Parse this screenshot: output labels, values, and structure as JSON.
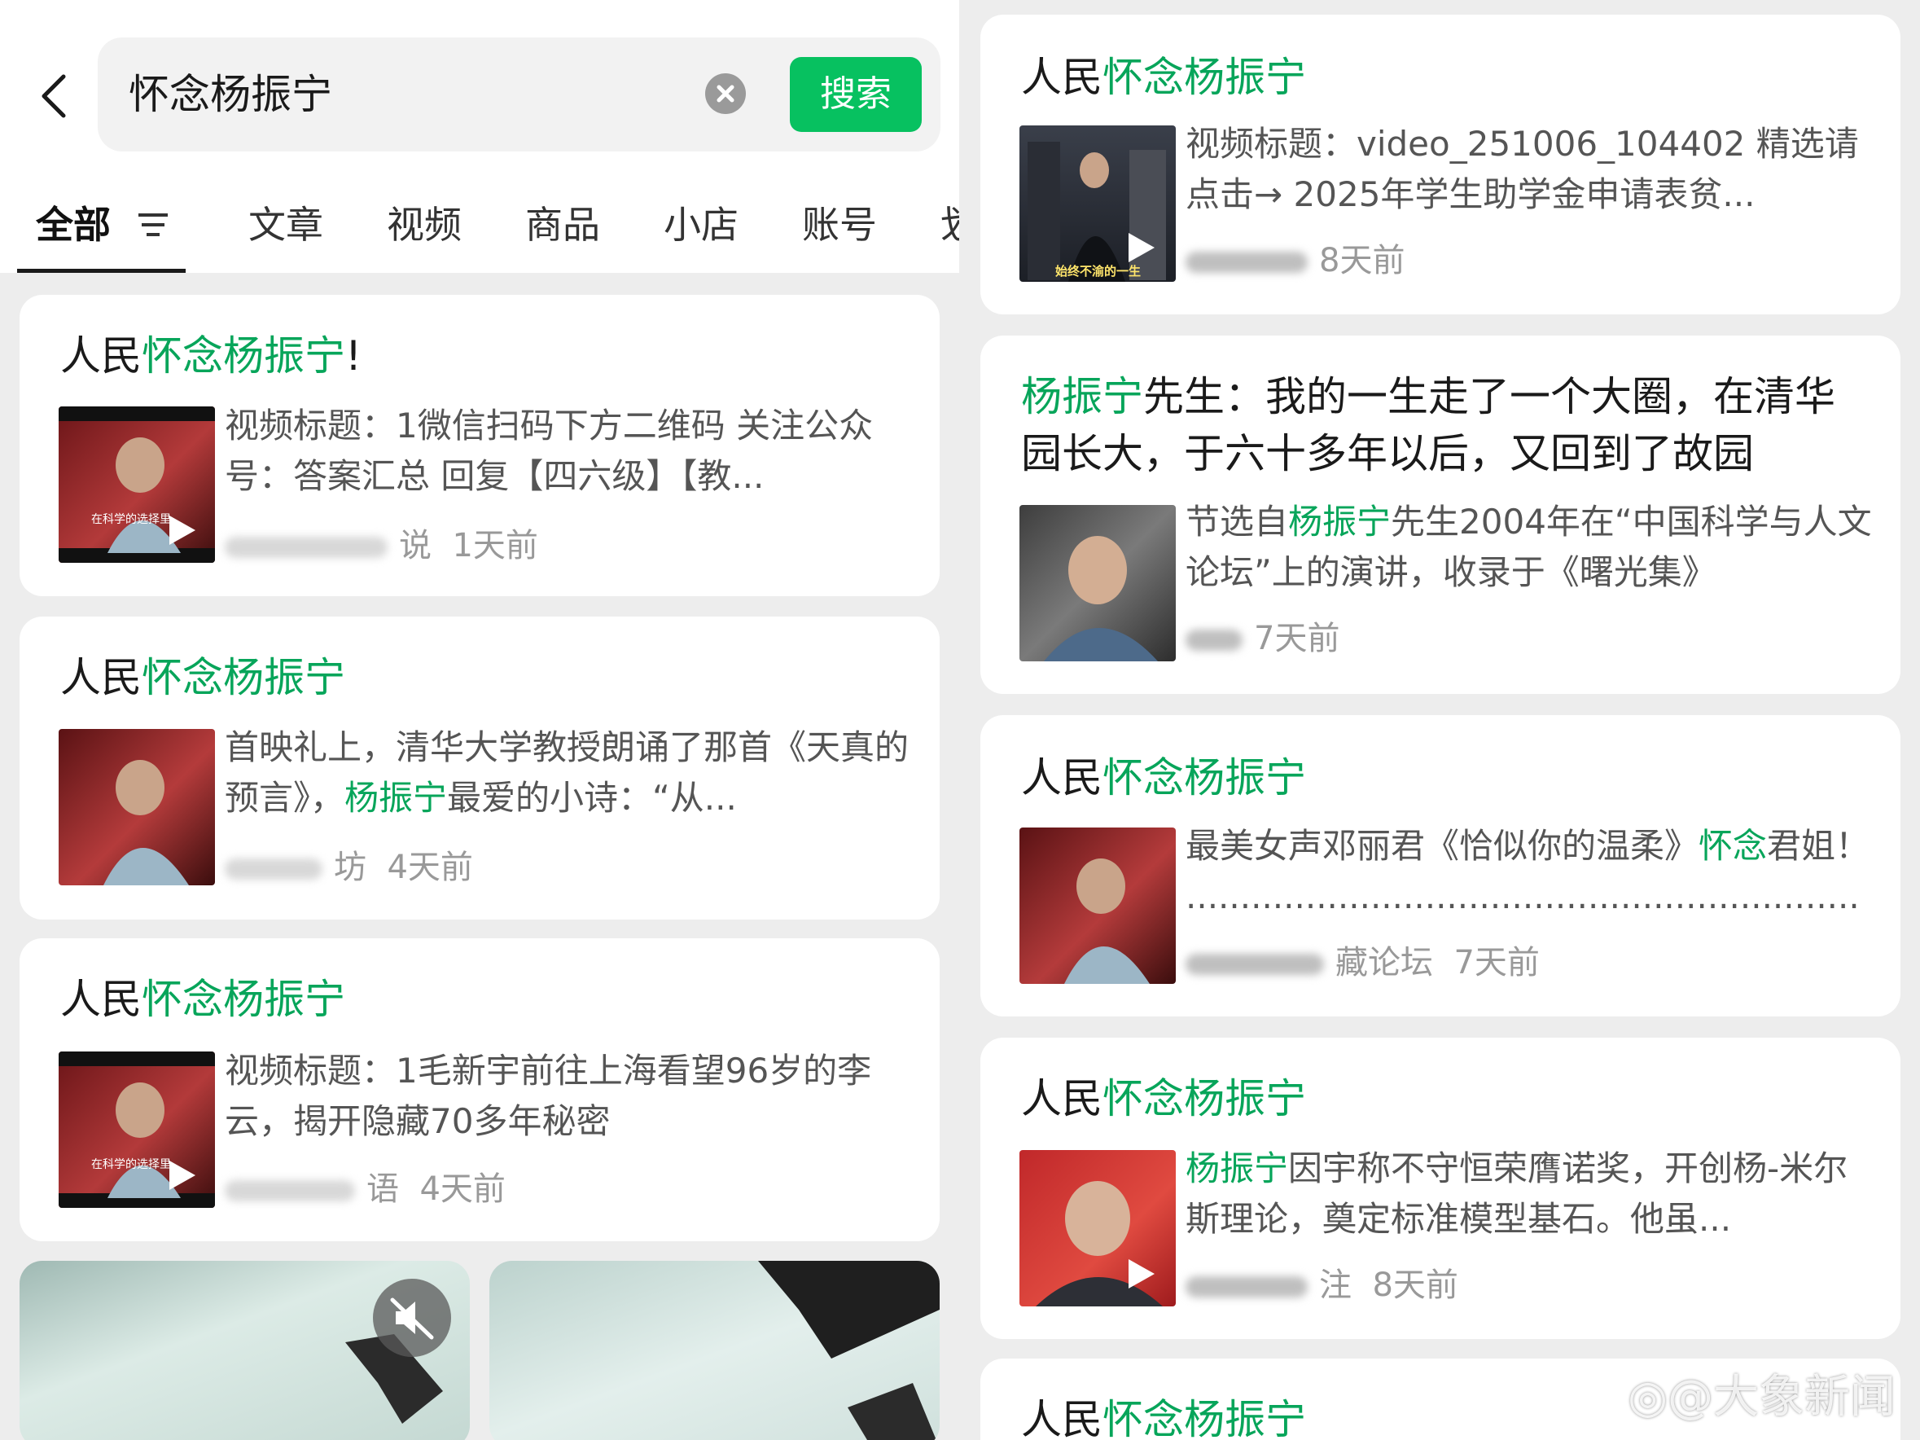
{
  "search": {
    "query": "怀念杨振宁",
    "button_label": "搜索"
  },
  "tabs": [
    "全部",
    "文章",
    "视频",
    "商品",
    "小店",
    "账号",
    "划"
  ],
  "left_results": [
    {
      "title_prefix": "人民",
      "title_highlight": "怀念杨振宁",
      "title_suffix": "!",
      "desc_pre": "视频标题：1微信扫码下方二维码 关注公众号：答案汇总 回复【四六级】【教...",
      "desc_highlight": "",
      "desc_post": "",
      "source_visible": "说",
      "time": "1天前",
      "thumb_caption": "在科学的选择里"
    },
    {
      "title_prefix": "人民",
      "title_highlight": "怀念杨振宁",
      "title_suffix": "",
      "desc_pre": "首映礼上，清华大学教授朗诵了那首《天真的预言》，",
      "desc_highlight": "杨振宁",
      "desc_post": "最爱的小诗：“从...",
      "source_visible": "坊",
      "time": "4天前",
      "thumb_caption": ""
    },
    {
      "title_prefix": "人民",
      "title_highlight": "怀念杨振宁",
      "title_suffix": "",
      "desc_pre": "视频标题：1毛新宇前往上海看望96岁的李云，揭开隐藏70多年秘密",
      "desc_highlight": "",
      "desc_post": "",
      "source_visible": "语",
      "time": "4天前",
      "thumb_caption": "在科学的选择里"
    }
  ],
  "right_results": [
    {
      "title_prefix": "人民",
      "title_highlight": "怀念杨振宁",
      "title_suffix": "",
      "desc_pre": "视频标题：video_251006_104402 精选请点击→ 2025年学生助学金申请表贫...",
      "desc_highlight": "",
      "desc_post": "",
      "source_visible": "",
      "time": "8天前",
      "thumb_caption": "始终不渝的一生"
    },
    {
      "title_prefix": "",
      "title_highlight": "杨振宁",
      "title_suffix": "先生：我的一生走了一个大圈，在清华园长大，于六十多年以后，又回到了故园",
      "desc_pre": "节选自",
      "desc_highlight": "杨振宁",
      "desc_post": "先生2004年在“中国科学与人文论坛”上的演讲，收录于《曙光集》",
      "source_visible": "",
      "time": "7天前",
      "thumb_caption": ""
    },
    {
      "title_prefix": "人民",
      "title_highlight": "怀念杨振宁",
      "title_suffix": "",
      "desc_pre": "最美女声邓丽君《恰似你的温柔》",
      "desc_highlight": "怀念",
      "desc_post": "君姐！ ..............................................................",
      "source_visible": "藏论坛",
      "time": "7天前",
      "thumb_caption": ""
    },
    {
      "title_prefix": "",
      "title_highlight": "杨振宁",
      "title_suffix": "",
      "desc_pre": "",
      "desc_highlight": "杨振宁",
      "desc_post": "因宇称不守恒荣膺诺奖，开创杨-米尔斯理论，奠定标准模型基石。他虽...",
      "source_visible": "注",
      "time": "8天前",
      "thumb_caption": ""
    },
    {
      "title_prefix": "人民",
      "title_highlight": "怀念杨振宁",
      "title_suffix": "",
      "desc_pre": "",
      "desc_highlight": "",
      "desc_post": "",
      "source_visible": "",
      "time": "",
      "thumb_caption": ""
    }
  ],
  "watermark": "@大象新闻",
  "colors": {
    "accent_green": "#07c160",
    "highlight_green": "#07a55a",
    "background": "#ededed"
  },
  "icons": [
    "back-arrow-icon",
    "clear-icon",
    "filter-icon",
    "play-icon",
    "mute-icon",
    "weibo-icon"
  ]
}
